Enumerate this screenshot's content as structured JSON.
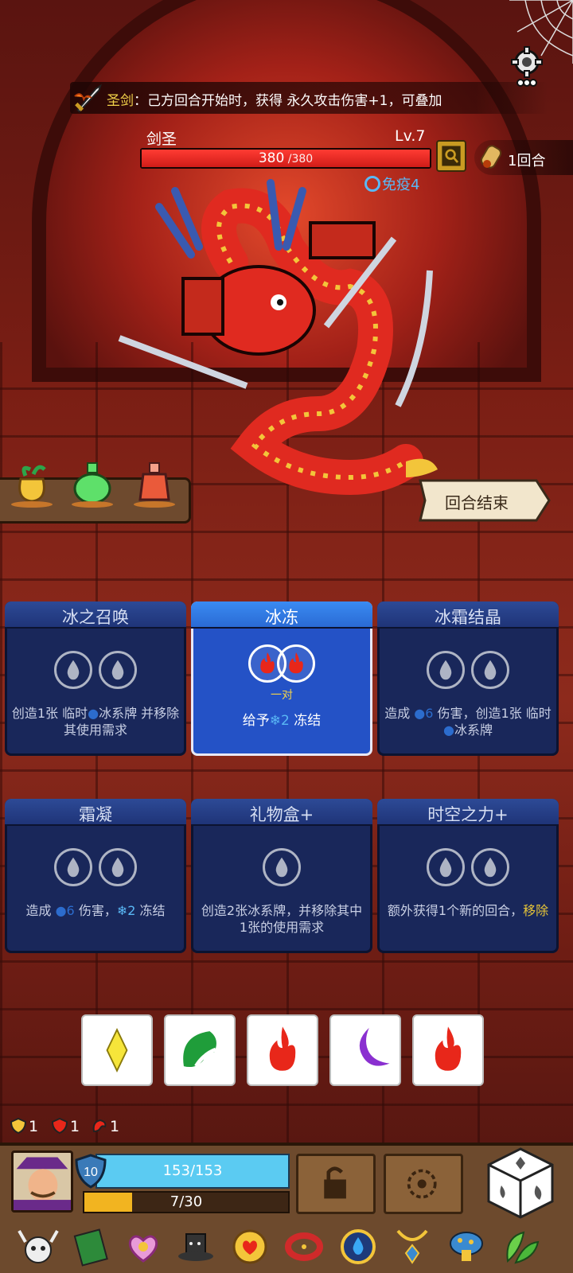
{
  "relic": {
    "name": "圣剑",
    "separator": "：",
    "effect": "己方回合开始时，获得 永久攻击伤害+1，可叠加"
  },
  "enemy": {
    "name": "剑圣",
    "level": "Lv.7",
    "hp_current": "380",
    "hp_max": " /380",
    "hp_fraction": 1.0,
    "status_immune": "免疫4"
  },
  "round": {
    "label": "1回合"
  },
  "end_turn": {
    "label": "回合结束"
  },
  "cards": [
    {
      "title": "冰之召唤",
      "desc_parts": [
        "创造1张 临时",
        "冰系牌 并移除其使用需求"
      ]
    },
    {
      "title": "冰冻",
      "pair_label": "一对",
      "desc_prefix": "给予",
      "desc_value": "2",
      "desc_suffix": " 冻结"
    },
    {
      "title": "冰霜结晶",
      "desc_a": "造成 ",
      "desc_value": "6",
      "desc_b": " 伤害，创造1张 临时",
      "desc_c": "冰系牌"
    },
    {
      "title": "霜凝",
      "desc_a": "造成 ",
      "desc_value": "6",
      "desc_b": " 伤害，",
      "desc_value2": "2",
      "desc_c": " 冻结"
    },
    {
      "title": "礼物盒+",
      "desc": "创造2张冰系牌，并移除其中1张的使用需求"
    },
    {
      "title": "时空之力+",
      "desc_a": "额外获得1个新的回合，",
      "desc_highlight": "移除"
    }
  ],
  "dice": [
    {
      "icon": "lightning-diamond-icon",
      "color": "#f6e53a"
    },
    {
      "icon": "leaf-icon",
      "color": "#1f9d3a"
    },
    {
      "icon": "fire-icon",
      "color": "#e8271a"
    },
    {
      "icon": "moon-icon",
      "color": "#8a2fd0"
    },
    {
      "icon": "fire-icon",
      "color": "#e8271a"
    }
  ],
  "mini_stats": {
    "shield": "1",
    "heart": "1",
    "rage": "1"
  },
  "player": {
    "level": "10",
    "hp_text": "153/153",
    "hp_fraction": 1.0,
    "exp_text": "7/30",
    "exp_fraction": 0.2333
  },
  "colors": {
    "accent_gold": "#f3d34a",
    "ice_blue": "#5ab8f5",
    "hp_red": "#e8271a",
    "card_blue": "#19275a",
    "active_card_blue": "#2452c6"
  }
}
